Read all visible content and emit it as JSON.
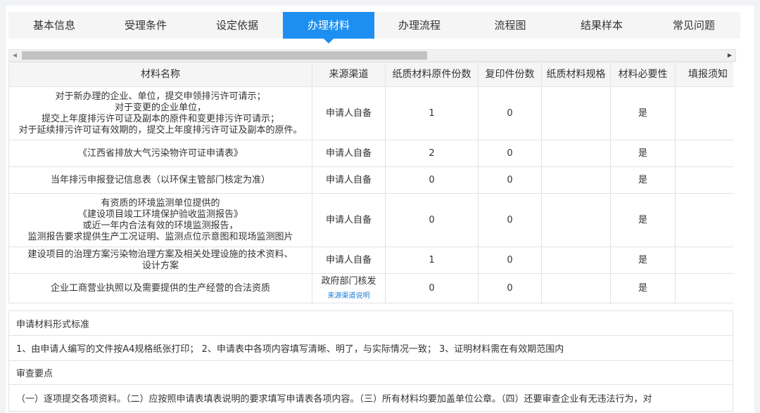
{
  "tabs": [
    {
      "label": "基本信息",
      "active": false
    },
    {
      "label": "受理条件",
      "active": false
    },
    {
      "label": "设定依据",
      "active": false
    },
    {
      "label": "办理材料",
      "active": true
    },
    {
      "label": "办理流程",
      "active": false
    },
    {
      "label": "流程图",
      "active": false
    },
    {
      "label": "结果样本",
      "active": false
    },
    {
      "label": "常见问题",
      "active": false
    }
  ],
  "table": {
    "headers": [
      "材料名称",
      "来源渠道",
      "纸质材料原件份数",
      "复印件份数",
      "纸质材料规格",
      "材料必要性",
      "填报须知"
    ],
    "rows": [
      {
        "name_lines": [
          "对于新办理的企业、单位，提交申领排污许可请示；",
          "对于变更的企业单位，",
          "提交上年度排污许可证及副本的原件和变更排污许可请示；",
          "对于延续排污许可证有效期的，提交上年度排污许可证及副本的原件。"
        ],
        "source": "申请人自备",
        "original": "1",
        "copies": "0",
        "spec": "",
        "required": "是",
        "note": ""
      },
      {
        "name_lines": [
          "《江西省排放大气污染物许可证申请表》"
        ],
        "source": "申请人自备",
        "original": "2",
        "copies": "0",
        "spec": "",
        "required": "是",
        "note": ""
      },
      {
        "name_lines": [
          "当年排污申报登记信息表（以环保主管部门核定为准）"
        ],
        "source": "申请人自备",
        "original": "0",
        "copies": "0",
        "spec": "",
        "required": "是",
        "note": ""
      },
      {
        "name_lines": [
          "有资质的环境监测单位提供的",
          "《建设项目竣工环境保护验收监测报告》",
          "或近一年内合法有效的环境监测报告，",
          "监测报告要求提供生产工况证明、监测点位示意图和现场监测图片"
        ],
        "source": "申请人自备",
        "original": "0",
        "copies": "0",
        "spec": "",
        "required": "是",
        "note": ""
      },
      {
        "name_lines": [
          "建设项目的治理方案污染物治理方案及相关处理设施的技术资料、",
          "设计方案"
        ],
        "source": "申请人自备",
        "original": "1",
        "copies": "0",
        "spec": "",
        "required": "是",
        "note": ""
      },
      {
        "name_lines": [
          "企业工商营业执照以及需要提供的生产经营的合法资质"
        ],
        "source": "政府部门核发",
        "source_link": "来源渠道说明",
        "original": "0",
        "copies": "0",
        "spec": "",
        "required": "是",
        "note": ""
      }
    ]
  },
  "sections": {
    "form_standard_title": "申请材料形式标准",
    "form_standard_text": "1、由申请人编写的文件按A4规格纸张打印；  2、申请表中各项内容填写清晰、明了，与实际情况一致；  3、证明材料需在有效期范围内",
    "review_title": "审查要点",
    "review_text": "（一）逐项提交各项资料。（二）应按照申请表填表说明的要求填写申请表各项内容。（三）所有材料均要加盖单位公章。（四）还要审查企业有无违法行为，对"
  },
  "colors": {
    "accent": "#1d8ff0",
    "link": "#1e7fd6",
    "border": "#e3e3e3"
  }
}
